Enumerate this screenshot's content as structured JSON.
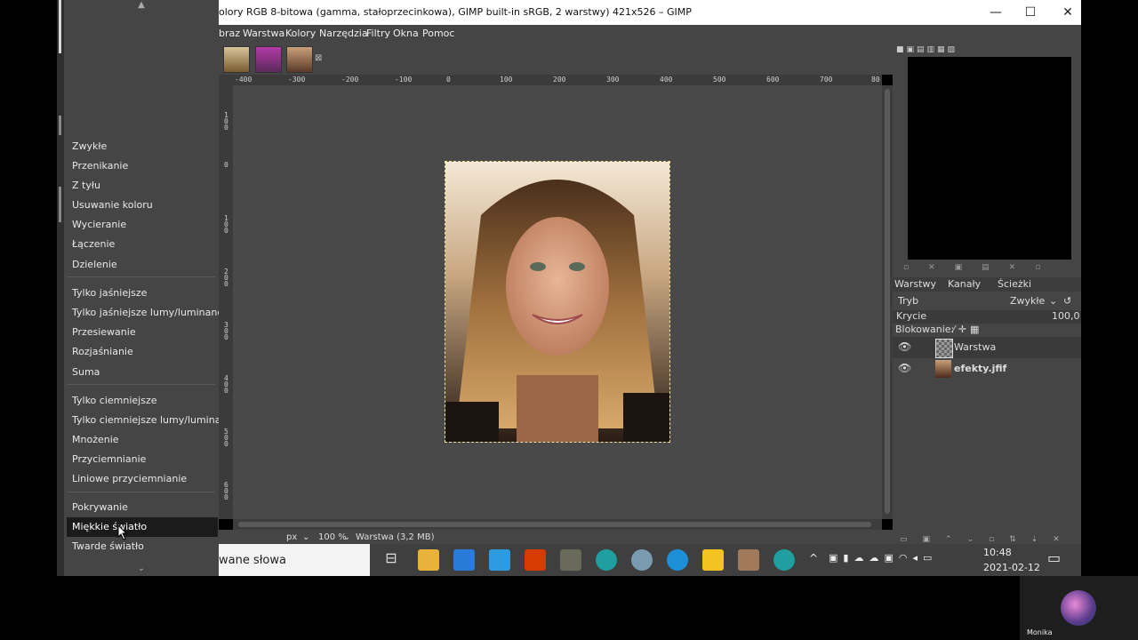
{
  "window": {
    "title": "olory RGB 8-bitowa (gamma, stałoprzecinkowa), GIMP built-in sRGB, 2 warstwy) 421x526 – GIMP",
    "minimize": "—",
    "maximize": "☐",
    "close": "✕"
  },
  "menubar": [
    "braz",
    "Warstwa",
    "Kolory",
    "Narzędzia",
    "Filtry",
    "Okna",
    "Pomoc"
  ],
  "blend_menu": {
    "up_arrow": "▲",
    "down_arrow": "⌄",
    "groups": [
      [
        "Zwykłe",
        "Przenikanie",
        "Z tyłu",
        "Usuwanie koloru",
        "Wycieranie",
        "Łączenie",
        "Dzielenie"
      ],
      [
        "Tylko jaśniejsze",
        "Tylko jaśniejsze lumy/luminancji",
        "Przesiewanie",
        "Rozjaśnianie",
        "Suma"
      ],
      [
        "Tylko ciemniejsze",
        "Tylko ciemniejsze lumy/luminancji",
        "Mnożenie",
        "Przyciemnianie",
        "Liniowe przyciemnianie"
      ],
      [
        "Pokrywanie",
        "Miękkie światło",
        "Twarde światło"
      ]
    ],
    "selected": "Miękkie światło"
  },
  "ruler_h": [
    "-400",
    "-300",
    "-200",
    "-100",
    "0",
    "100",
    "200",
    "300",
    "400",
    "500",
    "600",
    "700",
    "80"
  ],
  "ruler_v": [
    "1\n0\n0",
    "0",
    "1\n0\n0",
    "2\n0\n0",
    "3\n0\n0",
    "4\n0\n0",
    "5\n0\n0",
    "6\n0\n0"
  ],
  "statusbar": {
    "unit": "px",
    "zoom": "100 %",
    "layer_info": "Warstwa (3,2 MB)"
  },
  "dock": {
    "tabs": [
      "Warstwy",
      "Kanały",
      "Ścieżki"
    ],
    "mode_label": "Tryb",
    "mode_value": "Zwykłe",
    "opacity_label": "Krycie",
    "opacity_value": "100,0",
    "lock_label": "Blokowanie:",
    "layers": [
      {
        "name": "Warstwa",
        "visible": true
      },
      {
        "name": "efekty.jfif",
        "visible": true
      }
    ]
  },
  "taskbar": {
    "search_text": "wane słowa",
    "time": "10:48",
    "date": "2021-02-12"
  },
  "webcam": {
    "name": "Monika"
  },
  "colors": {
    "gimp_bg": "#454545",
    "canvas_bg": "#494949",
    "selected_item": "#1b1b1b",
    "taskbar": "#3f3f3f"
  }
}
